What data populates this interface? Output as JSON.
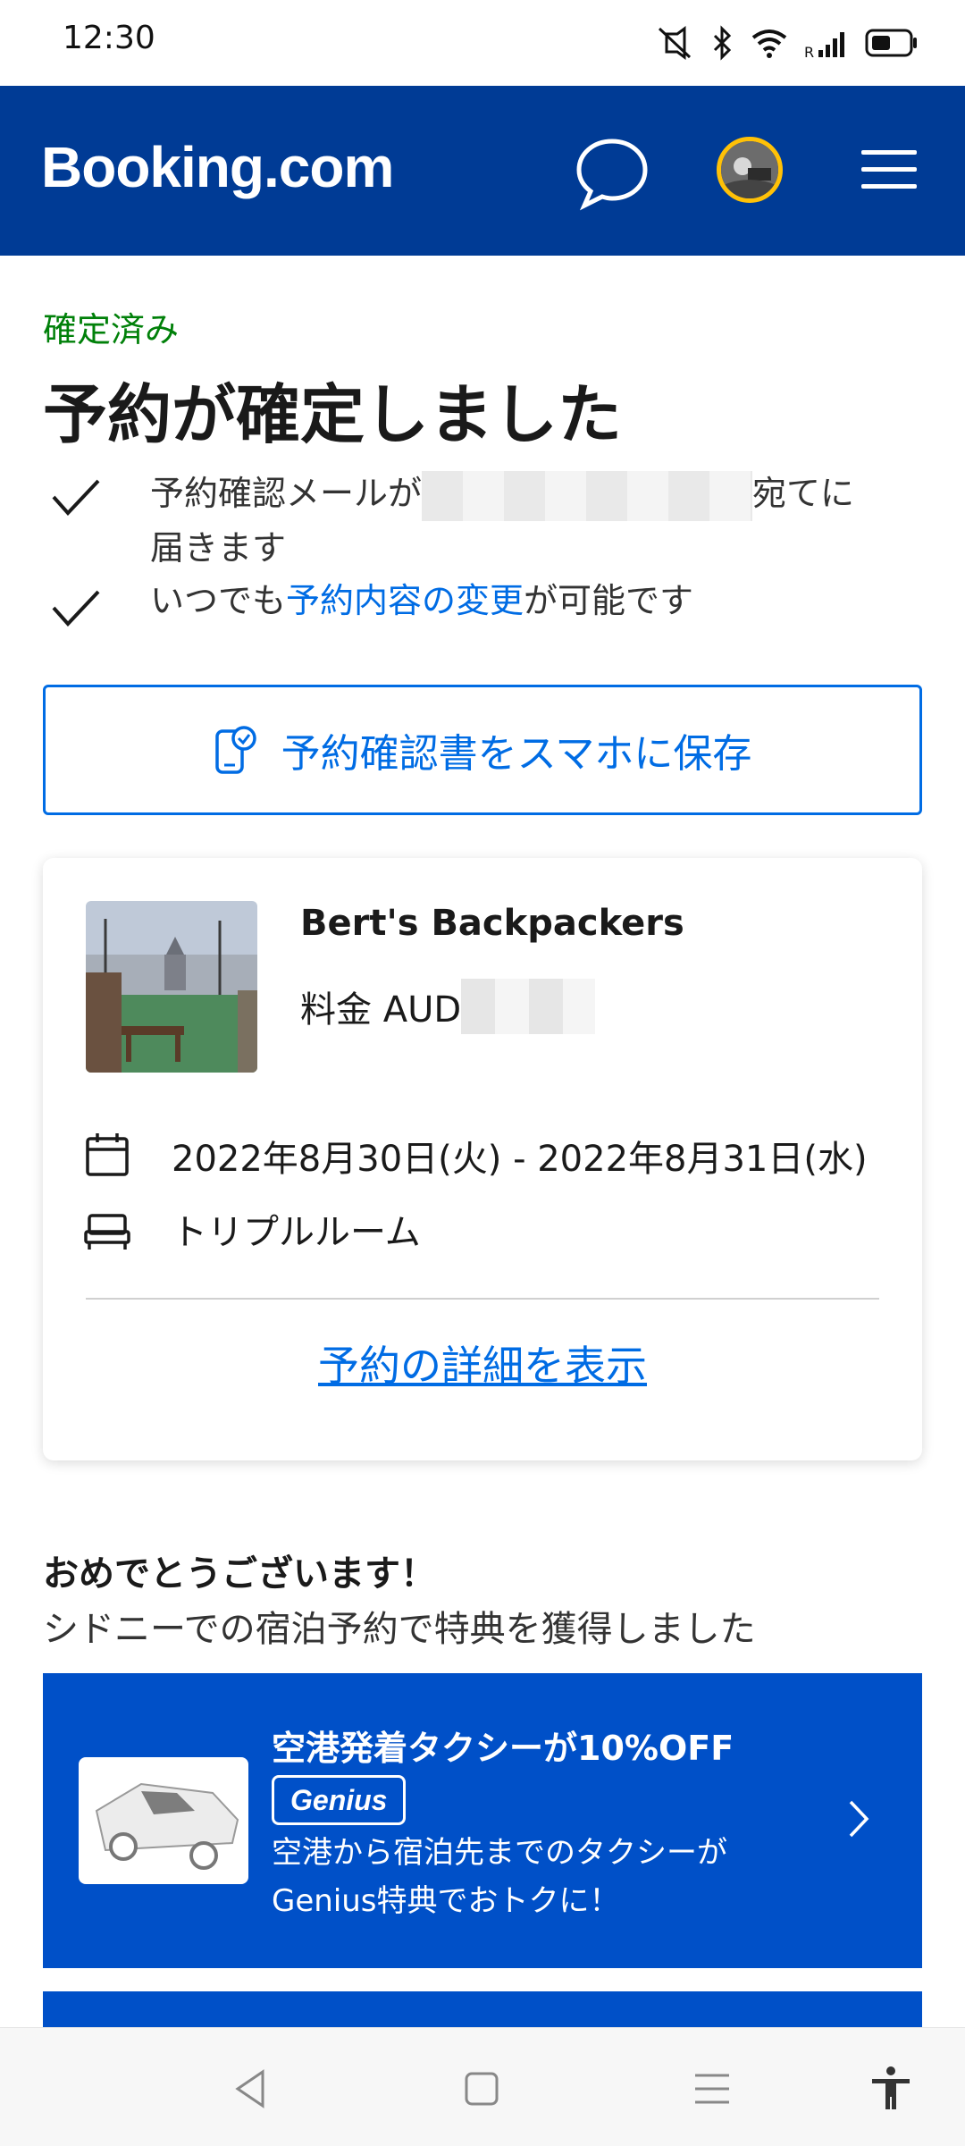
{
  "status_bar": {
    "time": "12:30",
    "icons": [
      "mute-icon",
      "bluetooth-icon",
      "wifi-icon",
      "signal-icon",
      "battery-icon"
    ]
  },
  "header": {
    "logo": "Booking.com",
    "icons": [
      "chat-icon",
      "avatar",
      "hamburger-menu-icon"
    ],
    "bg_color": "#003b95"
  },
  "confirmation": {
    "status": "確定済み",
    "title": "予約が確定しました",
    "bullet1_prefix": "予約確認メールが",
    "bullet1_suffix": "宛てに",
    "bullet1_line2": "届きます",
    "bullet2_prefix": "いつでも",
    "bullet2_link": "予約内容の変更",
    "bullet2_suffix": "が可能です"
  },
  "save_button": {
    "label": "予約確認書をスマホに保存"
  },
  "booking_card": {
    "hotel_name": "Bert's Backpackers",
    "price_label": "料金 AUD",
    "dates": "2022年8月30日(火) - 2022年8月31日(水)",
    "room": "トリプルルーム",
    "details_link": "予約の詳細を表示"
  },
  "promo": {
    "congrats_title": "おめでとうございます！",
    "congrats_sub": "シドニーでの宿泊予約で特典を獲得しました",
    "card_title": "空港発着タクシーが10%OFF",
    "badge": "Genius",
    "desc_line1": "空港から宿泊先までのタクシーが",
    "desc_line2": "Genius特典でおトクに！",
    "bg_color": "#0050c8"
  },
  "nav_bar": {
    "buttons": [
      "back-icon",
      "home-icon",
      "recents-icon",
      "accessibility-icon"
    ]
  }
}
